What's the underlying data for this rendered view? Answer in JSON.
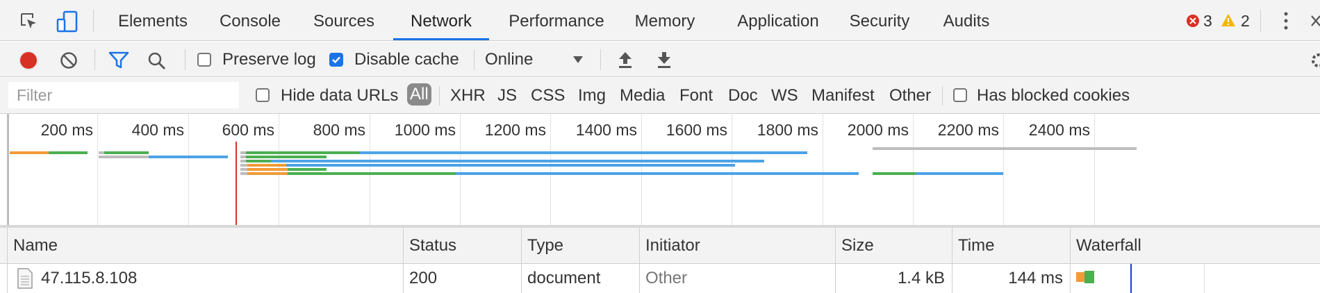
{
  "tabs": [
    {
      "label": "Elements"
    },
    {
      "label": "Console"
    },
    {
      "label": "Sources"
    },
    {
      "label": "Network",
      "active": true
    },
    {
      "label": "Performance"
    },
    {
      "label": "Memory"
    },
    {
      "label": "Application"
    },
    {
      "label": "Security"
    },
    {
      "label": "Audits"
    }
  ],
  "status": {
    "errors": "3",
    "warnings": "2"
  },
  "toolbar": {
    "preserve_log": {
      "label": "Preserve log",
      "checked": false
    },
    "disable_cache": {
      "label": "Disable cache",
      "checked": true
    },
    "throttling": "Online"
  },
  "filter": {
    "placeholder": "Filter",
    "hide_data_urls": {
      "label": "Hide data URLs",
      "checked": false
    },
    "types": [
      "All",
      "XHR",
      "JS",
      "CSS",
      "Img",
      "Media",
      "Font",
      "Doc",
      "WS",
      "Manifest",
      "Other"
    ],
    "selected_type": "All",
    "blocked_cookies": {
      "label": "Has blocked cookies",
      "checked": false
    }
  },
  "overview": {
    "ticks": [
      "200 ms",
      "400 ms",
      "600 ms",
      "800 ms",
      "1000 ms",
      "1200 ms",
      "1400 ms",
      "1600 ms",
      "1800 ms",
      "2000 ms",
      "2200 ms",
      "2400 ms"
    ]
  },
  "table": {
    "columns": [
      "Name",
      "Status",
      "Type",
      "Initiator",
      "Size",
      "Time",
      "Waterfall"
    ],
    "rows": [
      {
        "name": "47.115.8.108",
        "status": "200",
        "type": "document",
        "initiator": "Other",
        "size": "1.4 kB",
        "time": "144 ms"
      }
    ]
  },
  "colors": {
    "accent": "#1a73e8",
    "record": "#d93025",
    "error": "#d93025",
    "warning": "#f2b600",
    "waiting": "#f29b38",
    "receiving": "#4caf50",
    "download": "#4da3e6"
  }
}
